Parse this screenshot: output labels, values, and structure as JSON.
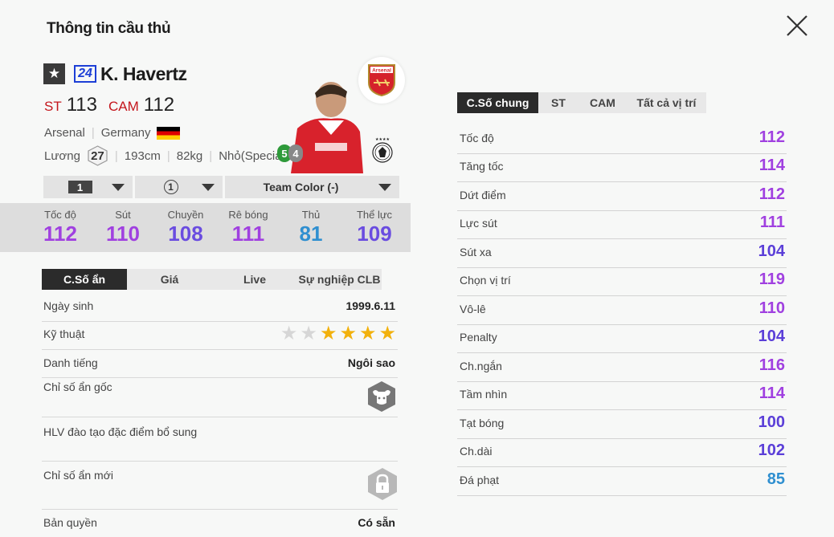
{
  "header": {
    "title": "Thông tin cầu thủ"
  },
  "player": {
    "season_number": "24",
    "name": "K. Havertz",
    "positions": [
      {
        "pos": "ST",
        "ovr": "113"
      },
      {
        "pos": "CAM",
        "ovr": "112"
      }
    ],
    "club": "Arsenal",
    "nation": "Germany",
    "salary_label": "Lương",
    "salary": "27",
    "height": "193cm",
    "weight": "82kg",
    "body_type": "Nhỏ(Special)",
    "skill_moves": "5",
    "weak_foot": "4",
    "club_logo_text": "Arsenal"
  },
  "dropdowns": {
    "level": "1",
    "upgrade": "1",
    "team_color": "Team Color (-)"
  },
  "main_stats": [
    {
      "label": "Tốc độ",
      "value": "112",
      "color": "#a040e0"
    },
    {
      "label": "Sút",
      "value": "110",
      "color": "#a040e0"
    },
    {
      "label": "Chuyền",
      "value": "108",
      "color": "#6a4ce0"
    },
    {
      "label": "Rê bóng",
      "value": "111",
      "color": "#a040e0"
    },
    {
      "label": "Thủ",
      "value": "81",
      "color": "#2f8fd0"
    },
    {
      "label": "Thể lực",
      "value": "109",
      "color": "#6a4ce0"
    }
  ],
  "left_tabs": [
    "C.Số ẩn",
    "Giá",
    "Live",
    "Sự nghiệp CLB"
  ],
  "details": {
    "birth_label": "Ngày sinh",
    "birth": "1999.6.11",
    "skill_label": "Kỹ thuật",
    "skill_stars": 4,
    "skill_stars_total": 6,
    "fame_label": "Danh tiếng",
    "fame": "Ngôi sao",
    "hidden_orig_label": "Chỉ số ẩn gốc",
    "coach_label": "HLV đào tạo đặc điểm bổ sung",
    "hidden_new_label": "Chỉ số ẩn mới",
    "rights_label": "Bản quyền",
    "rights": "Có sẵn"
  },
  "right_tabs": [
    "C.Số chung",
    "ST",
    "CAM",
    "Tất cả vị trí"
  ],
  "right_stats": [
    {
      "label": "Tốc độ",
      "value": "112",
      "color": "#a040e0"
    },
    {
      "label": "Tăng tốc",
      "value": "114",
      "color": "#a040e0"
    },
    {
      "label": "Dứt điểm",
      "value": "112",
      "color": "#a040e0"
    },
    {
      "label": "Lực sút",
      "value": "111",
      "color": "#a040e0"
    },
    {
      "label": "Sút xa",
      "value": "104",
      "color": "#5b3fd8"
    },
    {
      "label": "Chọn vị trí",
      "value": "119",
      "color": "#a040e0"
    },
    {
      "label": "Vô-lê",
      "value": "110",
      "color": "#a040e0"
    },
    {
      "label": "Penalty",
      "value": "104",
      "color": "#5b3fd8"
    },
    {
      "label": "Ch.ngắn",
      "value": "116",
      "color": "#a040e0"
    },
    {
      "label": "Tầm nhìn",
      "value": "114",
      "color": "#a040e0"
    },
    {
      "label": "Tạt bóng",
      "value": "100",
      "color": "#5b3fd8"
    },
    {
      "label": "Ch.dài",
      "value": "102",
      "color": "#5b3fd8"
    },
    {
      "label": "Đá phạt",
      "value": "85",
      "color": "#2f8fd0"
    }
  ]
}
